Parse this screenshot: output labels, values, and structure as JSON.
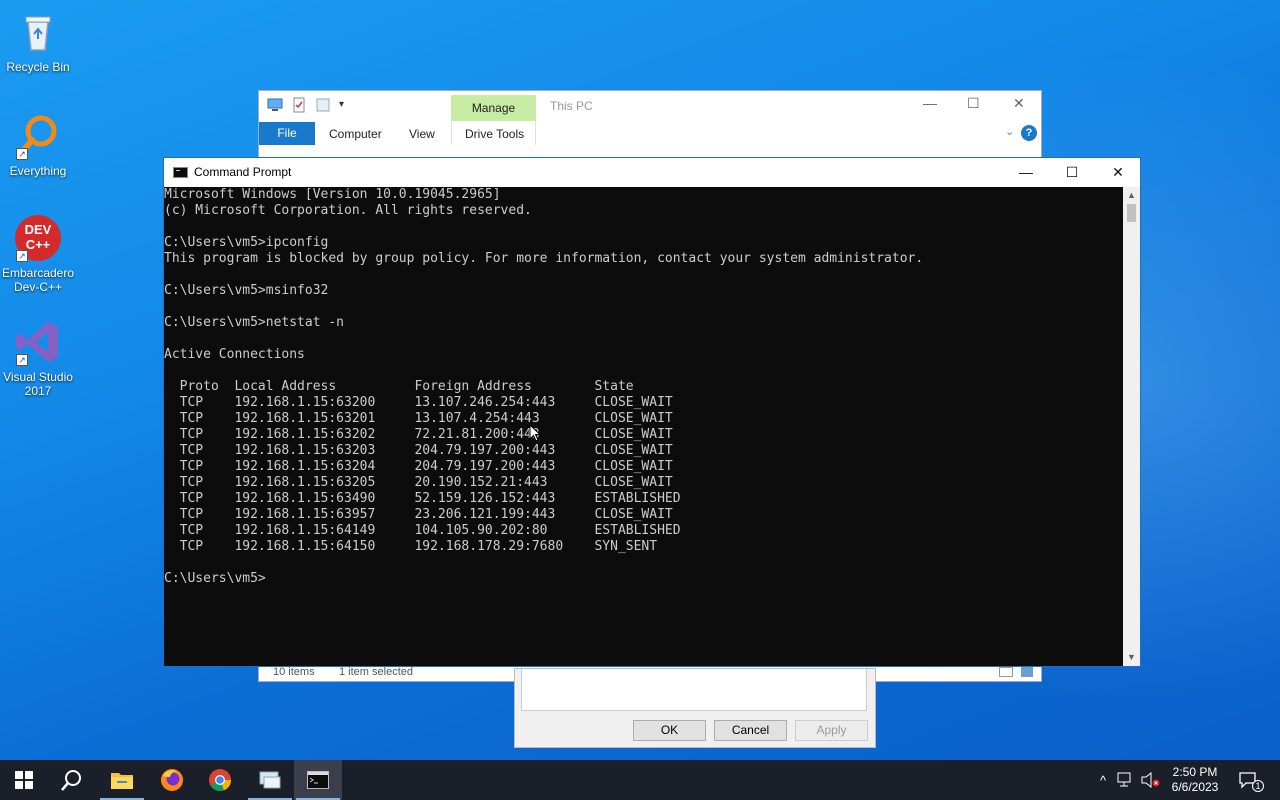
{
  "desktop": {
    "icons": [
      {
        "label": "Recycle Bin"
      },
      {
        "label": "Everything"
      },
      {
        "label": "Embarcadero Dev-C++",
        "logo_text": "DEV C++"
      },
      {
        "label": "Visual Studio 2017"
      }
    ]
  },
  "explorer": {
    "title": "This PC",
    "manage_tab": "Manage",
    "tabs": [
      "File",
      "Computer",
      "View",
      "Drive Tools"
    ],
    "status_items": "10 items",
    "status_selected": "1 item selected",
    "help": "?"
  },
  "dialog": {
    "buttons": [
      "OK",
      "Cancel",
      "Apply"
    ]
  },
  "cmd": {
    "title": "Command Prompt",
    "lines": [
      "Microsoft Windows [Version 10.0.19045.2965]",
      "(c) Microsoft Corporation. All rights reserved.",
      "",
      "C:\\Users\\vm5>ipconfig",
      "This program is blocked by group policy. For more information, contact your system administrator.",
      "",
      "C:\\Users\\vm5>msinfo32",
      "",
      "C:\\Users\\vm5>netstat -n",
      "",
      "Active Connections",
      "",
      "  Proto  Local Address          Foreign Address        State",
      "  TCP    192.168.1.15:63200     13.107.246.254:443     CLOSE_WAIT",
      "  TCP    192.168.1.15:63201     13.107.4.254:443       CLOSE_WAIT",
      "  TCP    192.168.1.15:63202     72.21.81.200:443       CLOSE_WAIT",
      "  TCP    192.168.1.15:63203     204.79.197.200:443     CLOSE_WAIT",
      "  TCP    192.168.1.15:63204     204.79.197.200:443     CLOSE_WAIT",
      "  TCP    192.168.1.15:63205     20.190.152.21:443      CLOSE_WAIT",
      "  TCP    192.168.1.15:63490     52.159.126.152:443     ESTABLISHED",
      "  TCP    192.168.1.15:63957     23.206.121.199:443     CLOSE_WAIT",
      "  TCP    192.168.1.15:64149     104.105.90.202:80      ESTABLISHED",
      "  TCP    192.168.1.15:64150     192.168.178.29:7680    SYN_SENT",
      "",
      "C:\\Users\\vm5>"
    ]
  },
  "taskbar": {
    "items": [
      "start-icon",
      "search-icon",
      "file-explorer-icon",
      "firefox-icon",
      "chrome-icon",
      "network-app-icon",
      "command-prompt-icon"
    ],
    "clock_time": "2:50 PM",
    "clock_date": "6/6/2023",
    "notification_count": "1"
  }
}
